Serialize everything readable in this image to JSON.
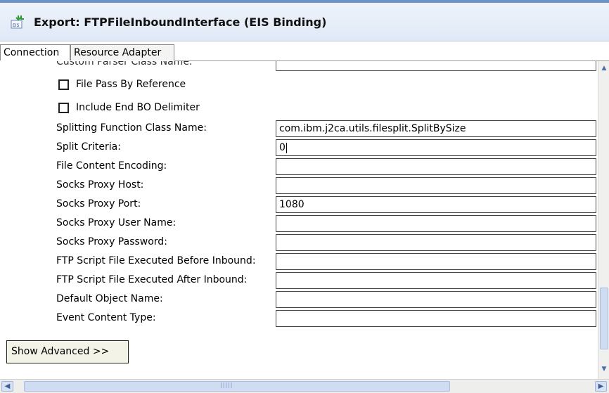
{
  "header": {
    "title": "Export: FTPFileInboundInterface (EIS Binding)",
    "icon": "eis-export-icon"
  },
  "tabs": [
    {
      "label": "Connection"
    },
    {
      "label": "Resource Adapter"
    }
  ],
  "cutoff_label": "Custom Parser Class Name:",
  "checkboxes": [
    {
      "label": "File Pass By Reference",
      "checked": false
    },
    {
      "label": "Include End BO Delimiter",
      "checked": false
    }
  ],
  "fields": [
    {
      "label": "Splitting Function Class Name:",
      "value": "com.ibm.j2ca.utils.filesplit.SplitBySize"
    },
    {
      "label": "Split Criteria:",
      "value": "0"
    },
    {
      "label": "File Content Encoding:",
      "value": ""
    },
    {
      "label": "Socks Proxy Host:",
      "value": ""
    },
    {
      "label": "Socks Proxy Port:",
      "value": "1080"
    },
    {
      "label": "Socks Proxy User Name:",
      "value": ""
    },
    {
      "label": "Socks Proxy Password:",
      "value": ""
    },
    {
      "label": "FTP Script File Executed Before Inbound:",
      "value": ""
    },
    {
      "label": "FTP Script File Executed After Inbound:",
      "value": ""
    },
    {
      "label": "Default Object Name:",
      "value": ""
    },
    {
      "label": "Event Content Type:",
      "value": ""
    }
  ],
  "show_advanced_label": "Show Advanced >>",
  "scrollbar": {
    "up": "▲",
    "down": "▼",
    "left": "◀",
    "right": "▶",
    "grip": "|||||"
  }
}
